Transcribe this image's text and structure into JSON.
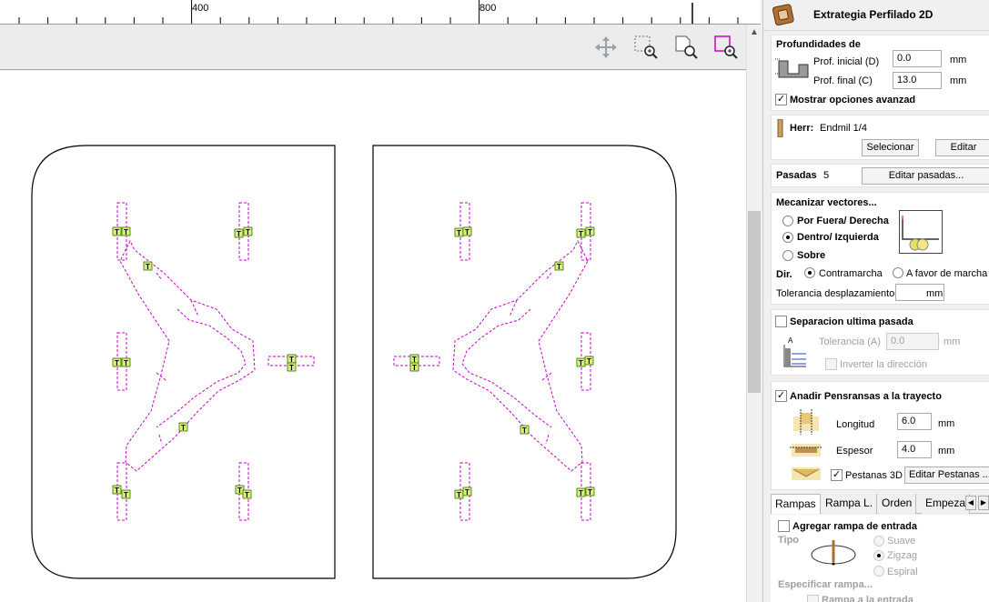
{
  "ruler": {
    "labels": [
      "400",
      "800"
    ]
  },
  "toolbar": {
    "icons": [
      "move-icon",
      "zoom-selection-icon",
      "zoom-page-icon",
      "zoom-box-icon"
    ]
  },
  "canvas": {
    "tab_label": "T",
    "colors": {
      "outline": "#000000",
      "vectors": "#cc00cc",
      "tab_fill": "#d7f07a",
      "tab_border": "#3a6b00"
    }
  },
  "panel": {
    "title": "Extrategia Perfilado 2D",
    "depths": {
      "heading": "Profundidades de",
      "start_label": "Prof. inicial (D)",
      "start_value": "0.0",
      "end_label": "Prof. final (C)",
      "end_value": "13.0",
      "unit": "mm",
      "advanced_label": "Mostrar opciones avanzad"
    },
    "tool": {
      "label": "Herr:",
      "name": "Endmil 1/4",
      "select_button": "Selecionar",
      "edit_button": "Editar"
    },
    "passes": {
      "label": "Pasadas",
      "count": "5",
      "edit_button": "Editar pasadas..."
    },
    "machine": {
      "heading": "Mecanizar vectores...",
      "outside": "Por Fuera/ Derecha",
      "inside": "Dentro/ Izquierda",
      "on": "Sobre",
      "dir_label": "Dir.",
      "climb": "Contramarcha",
      "conventional": "A favor de marcha",
      "tolerance_label": "Tolerancia desplazamiento",
      "tolerance_value": "",
      "unit": "mm"
    },
    "last_pass": {
      "heading": "Separacion ultima pasada",
      "tolerance_label": "Tolerancia (A)",
      "tolerance_value": "0.0",
      "unit": "mm",
      "invert_label": "Inverter la dirección"
    },
    "tabs_section": {
      "heading": "Anadir Pensransas a la trayecto",
      "length_label": "Longitud",
      "length_value": "6.0",
      "thickness_label": "Espesor",
      "thickness_value": "4.0",
      "unit": "mm",
      "tabs3d_label": "Pestanas 3D",
      "edit_button": "Editar Pestanas ..."
    },
    "bottom_tabs": [
      "Rampas",
      "Rampa L.",
      "Orden",
      "Empeza"
    ],
    "ramps": {
      "heading": "Agregar rampa de entrada",
      "type_label": "Tipo",
      "smooth": "Suave",
      "zigzag": "Zigzag",
      "spiral": "Espiral",
      "specify_label": "Especificar rampa...",
      "cut_label": "Rampa a la entrada"
    }
  }
}
